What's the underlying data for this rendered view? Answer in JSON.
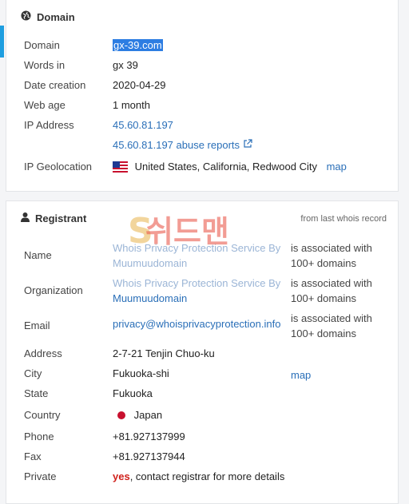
{
  "domain_card": {
    "title": "Domain",
    "rows": {
      "domain": {
        "label": "Domain",
        "value": "gx-39.com"
      },
      "words": {
        "label": "Words in",
        "value": "gx 39"
      },
      "date_creation": {
        "label": "Date creation",
        "value": "2020-04-29"
      },
      "web_age": {
        "label": "Web age",
        "value": "1 month"
      },
      "ip_address": {
        "label": "IP Address",
        "value": "45.60.81.197",
        "abuse_link": "45.60.81.197 abuse reports"
      },
      "ip_geolocation": {
        "label": "IP Geolocation",
        "value": "United States, California, Redwood City",
        "map_link": "map"
      }
    }
  },
  "registrant_card": {
    "title": "Registrant",
    "note": "from last whois record",
    "watermark_text": "쉬드맨",
    "rows": {
      "name": {
        "label": "Name",
        "value_line1": "Whois Privacy Protection Service By",
        "value_line2": "Muumuudomain",
        "assoc_line1": "is associated with",
        "assoc_line2": "100+ domains"
      },
      "organization": {
        "label": "Organization",
        "value_line1": "Whois Privacy Protection Service By",
        "value_line2": "Muumuudomain",
        "assoc_line1": "is associated with",
        "assoc_line2": "100+ domains"
      },
      "email": {
        "label": "Email",
        "value": "privacy@whoisprivacyprotection.info",
        "assoc_line1": "is associated with",
        "assoc_line2": "100+ domains"
      },
      "address": {
        "label": "Address",
        "value": "2-7-21 Tenjin Chuo-ku"
      },
      "city": {
        "label": "City",
        "value": "Fukuoka-shi",
        "map_link": "map"
      },
      "state": {
        "label": "State",
        "value": "Fukuoka"
      },
      "country": {
        "label": "Country",
        "value": "Japan"
      },
      "phone": {
        "label": "Phone",
        "value": "+81.927137999"
      },
      "fax": {
        "label": "Fax",
        "value": "+81.927137944"
      },
      "private": {
        "label": "Private",
        "yes": "yes",
        "rest": ", contact registrar for more details"
      }
    }
  },
  "colors": {
    "link": "#2a6fb8",
    "accent": "#1e9ee0",
    "selection": "#2d7de2",
    "private_yes": "#d0211c"
  }
}
